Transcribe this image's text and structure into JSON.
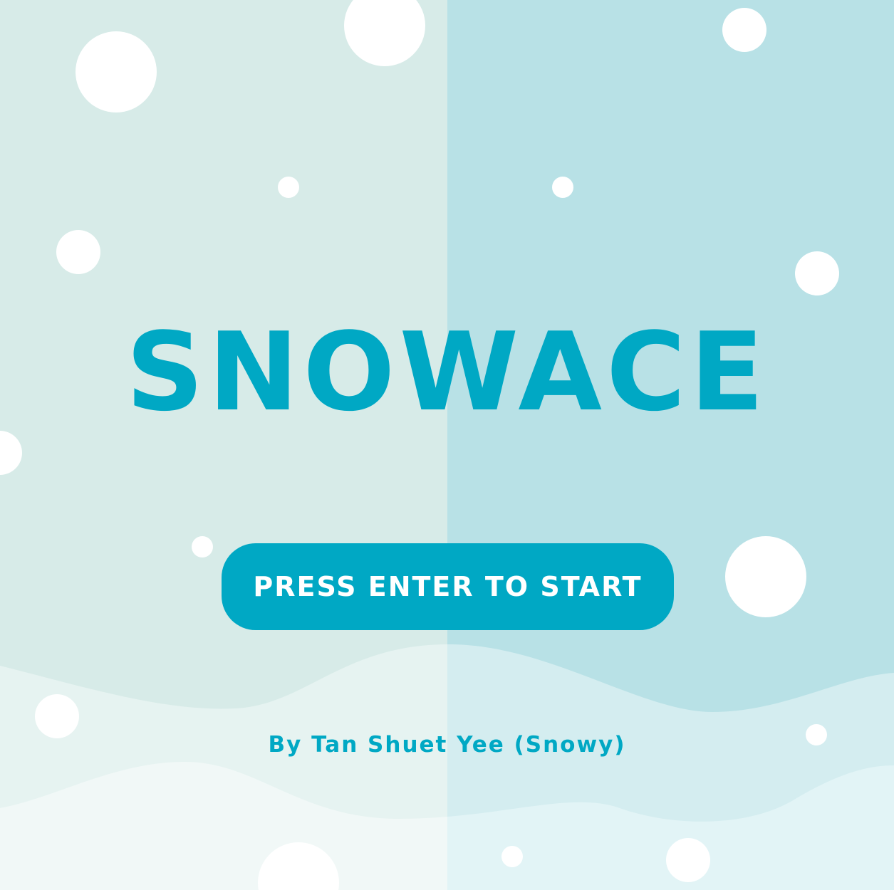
{
  "game": {
    "title": "SNOWACE",
    "start_prompt": "PRESS ENTER TO START",
    "credit": "By Tan Shuet Yee (Snowy)"
  },
  "colors": {
    "bg_left": "#d7ebe8",
    "bg_right": "#b8e1e6",
    "hill_back_left": "#e6f3f1",
    "hill_back_right": "#d4edf0",
    "hill_front_left": "#f1f8f7",
    "hill_front_right": "#e2f4f6",
    "accent": "#00a8c4",
    "button_text": "#ffffff",
    "snowflake": "#ffffff"
  }
}
